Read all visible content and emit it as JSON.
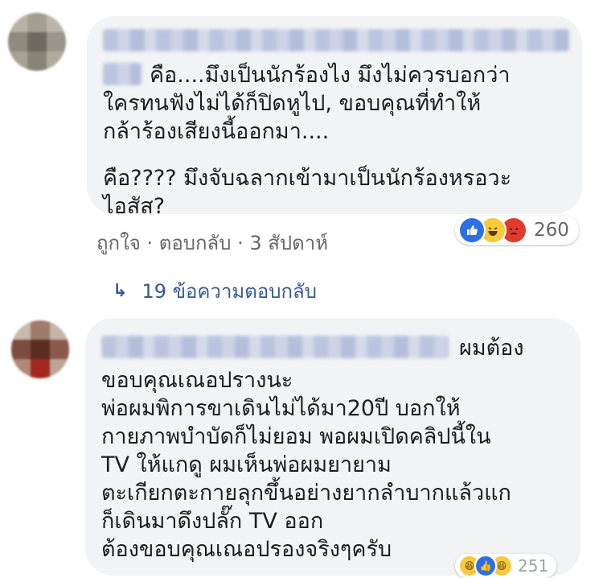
{
  "comments": [
    {
      "lead": "คือ....มึงเป็นนักร้องไง มึงไม่ควรบอกว่า",
      "body": "ใครทนฟังไม่ได้ก็ปิดหูไป, ขอบคุณที่ทำให้\nกล้าร้องเสียงนี้ออกมา....",
      "body2": "คือ???? มึงจับฉลากเข้ามาเป็นนักร้องหรอวะ\nไอสัส?",
      "actions": {
        "like": "ถูกใจ",
        "reply": "ตอบกลับ",
        "time": "3 สัปดาห์"
      },
      "reaction_count": "260",
      "reactions": [
        "like-icon",
        "haha-icon",
        "angry-icon"
      ],
      "replies_label": "19 ข้อความตอบกลับ"
    },
    {
      "lead": "ผมต้อง",
      "body": "ขอบคุณเณอปรางนะ\nพ่อผมพิการขาเดินไม่ได้มา20ปี บอกให้\nกายภาพบำบัดก็ไม่ยอม พอผมเปิดคลิปนี้ใน\nTV ให้แกดู ผมเห็นพ่อผมยายาม\nตะเกียกตะกายลุกขึ้นอย่างยากลำบากแล้วแก\nก็เดินมาดึงปลั๊ก TV ออก\nต้องขอบคุณเณอปรองจริงๆครับ",
      "reaction_count": "251",
      "reactions": [
        "haha-icon",
        "like-icon",
        "haha-icon"
      ]
    }
  ],
  "colors": {
    "bubble": "#f2f3f5",
    "link": "#385898",
    "meta": "#65676b",
    "like": "#2f6fe6",
    "haha": "#f7c93e",
    "angry": "#e23b2d"
  }
}
